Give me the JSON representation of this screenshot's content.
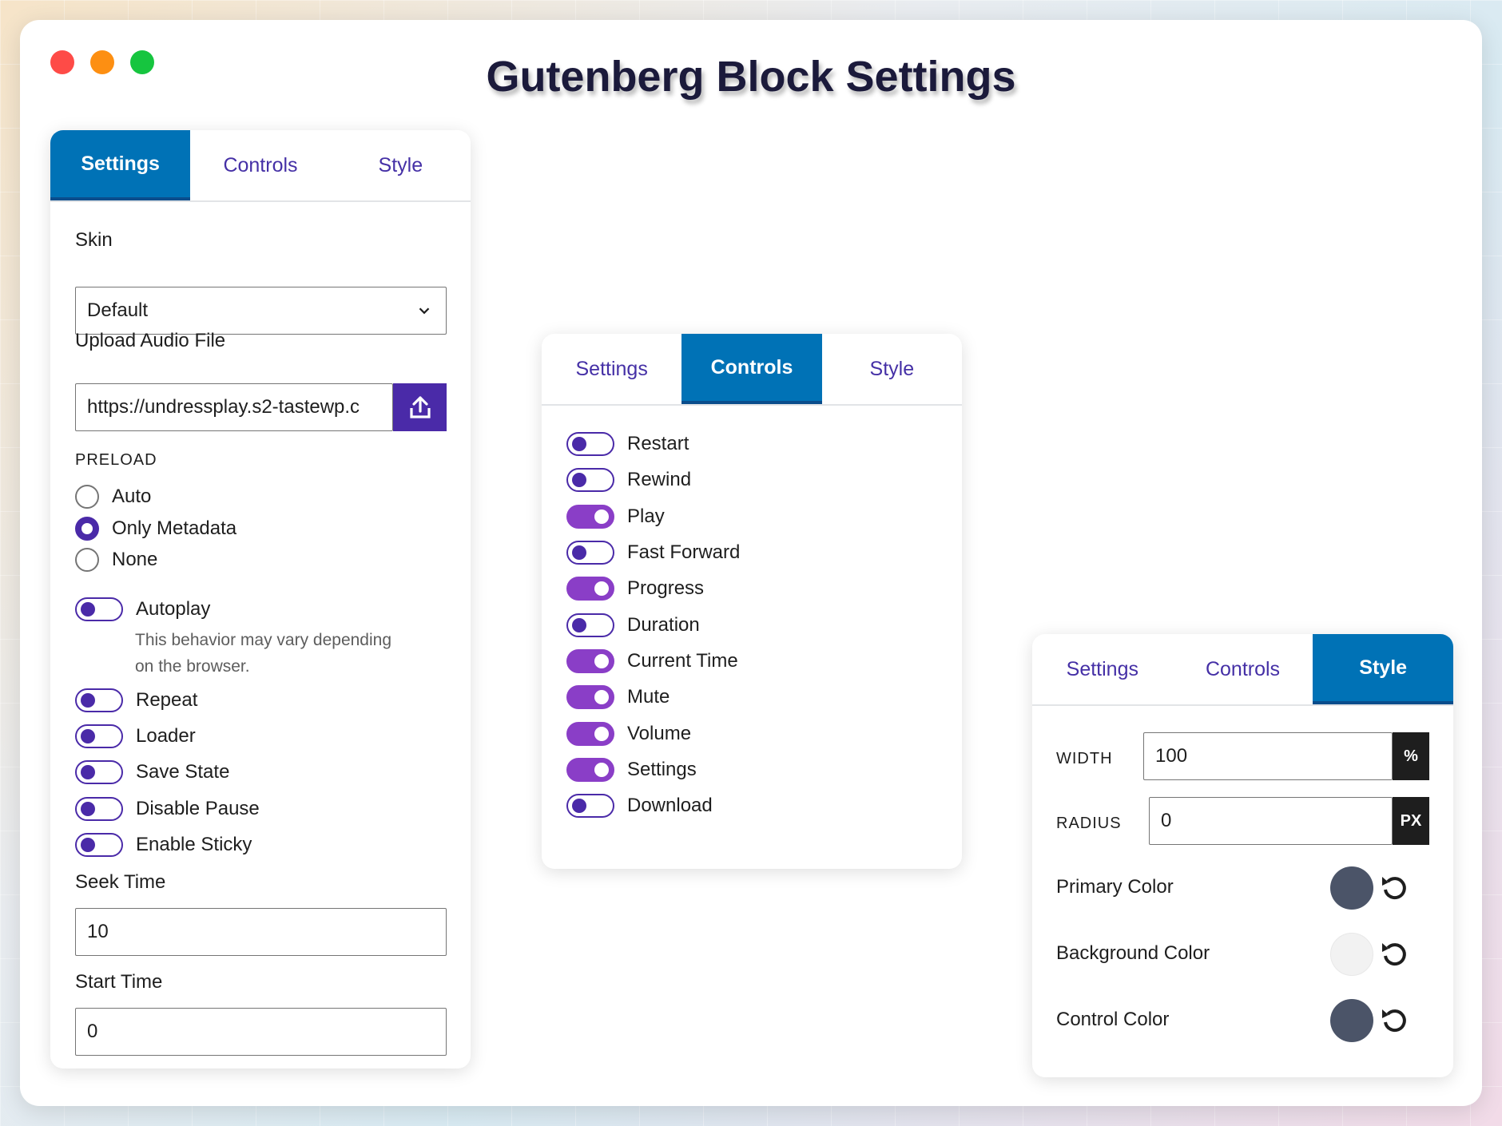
{
  "window": {
    "title": "Gutenberg Block Settings"
  },
  "tabs": {
    "settings": "Settings",
    "controls": "Controls",
    "style": "Style"
  },
  "settings_panel": {
    "skin_label": "Skin",
    "skin_value": "Default",
    "upload_label": "Upload Audio File",
    "upload_value": "https://undressplay.s2-tastewp.c",
    "preload_label": "PRELOAD",
    "preload_options": [
      "Auto",
      "Only Metadata",
      "None"
    ],
    "preload_selected": "Only Metadata",
    "autoplay_label": "Autoplay",
    "autoplay_help_line1": "This behavior may vary depending",
    "autoplay_help_line2": "on the browser.",
    "toggles": [
      {
        "label": "Repeat",
        "on": false
      },
      {
        "label": "Loader",
        "on": false
      },
      {
        "label": "Save State",
        "on": false
      },
      {
        "label": "Disable Pause",
        "on": false
      },
      {
        "label": "Enable Sticky",
        "on": false
      }
    ],
    "seek_label": "Seek Time",
    "seek_value": "10",
    "start_label": "Start Time",
    "start_value": "0"
  },
  "controls_panel": {
    "toggles": [
      {
        "label": "Restart",
        "on": false
      },
      {
        "label": "Rewind",
        "on": false
      },
      {
        "label": "Play",
        "on": true
      },
      {
        "label": "Fast Forward",
        "on": false
      },
      {
        "label": "Progress",
        "on": true
      },
      {
        "label": "Duration",
        "on": false
      },
      {
        "label": "Current Time",
        "on": true
      },
      {
        "label": "Mute",
        "on": true
      },
      {
        "label": "Volume",
        "on": true
      },
      {
        "label": "Settings",
        "on": true
      },
      {
        "label": "Download",
        "on": false
      }
    ]
  },
  "style_panel": {
    "width_label": "WIDTH",
    "width_value": "100",
    "width_unit": "%",
    "radius_label": "RADIUS",
    "radius_value": "0",
    "radius_unit": "PX",
    "primary_label": "Primary Color",
    "primary_color": "#4b5468",
    "background_label": "Background Color",
    "background_color": "#f2f2f2",
    "control_label": "Control Color",
    "control_color": "#4b5468"
  },
  "colors": {
    "accent": "#4a2aa8",
    "tab_active": "#0072b6",
    "toggle_on": "#8a3ec7"
  }
}
